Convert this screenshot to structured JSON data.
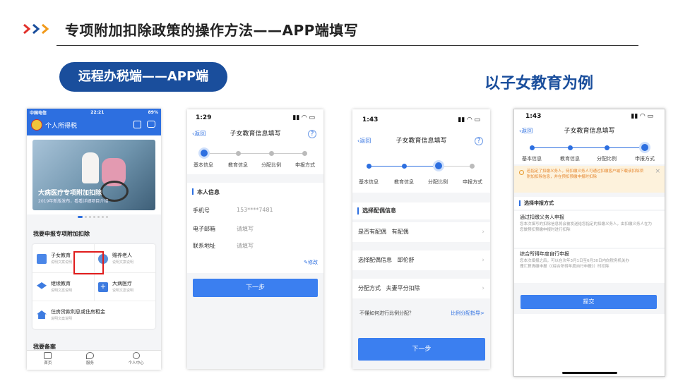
{
  "slide": {
    "title": "专项附加扣除政策的操作方法——APP端填写",
    "pill": "远程办税端——APP端",
    "example": "以子女教育为例"
  },
  "colors": {
    "accent": "#1a4e9c",
    "chevron_red": "#e1312b",
    "chevron_blue": "#1a4e9c",
    "chevron_orange": "#f19a1b",
    "app_blue": "#3b7ff0"
  },
  "phone1": {
    "status": {
      "carrier": "中国电信",
      "time": "22:21",
      "battery": "89%"
    },
    "app_title": "个人所得税",
    "banner": {
      "title": "大病医疗专项附加扣除",
      "subtitle": "2019年新版发布，看看详细项目介绍"
    },
    "section_title": "我要申报专项附加扣除",
    "items": [
      {
        "label": "子女教育",
        "desc": "说明文案说明"
      },
      {
        "label": "赡养老人",
        "desc": "说明文案说明"
      },
      {
        "label": "继续教育",
        "desc": "说明文案说明"
      },
      {
        "label": "大病医疗",
        "desc": "说明文案说明"
      },
      {
        "label": "住房贷款利息或住房租金",
        "desc": "说明文案说明"
      }
    ],
    "backup_title": "我要备案",
    "tabs": [
      "首页",
      "服务",
      "个人中心"
    ]
  },
  "phone2": {
    "time": "1:29",
    "back": "返回",
    "nav_title": "子女教育信息填写",
    "steps": [
      "基本信息",
      "教育信息",
      "分配比例",
      "申报方式"
    ],
    "section": "本人信息",
    "fields": [
      {
        "label": "手机号",
        "value": "153****7481"
      },
      {
        "label": "电子邮箱",
        "value": "请填写"
      },
      {
        "label": "联系地址",
        "value": "请填写"
      }
    ],
    "edit": "修改",
    "next": "下一步"
  },
  "phone3": {
    "time": "1:43",
    "back": "返回",
    "nav_title": "子女教育信息填写",
    "steps": [
      "基本信息",
      "教育信息",
      "分配比例",
      "申报方式"
    ],
    "section": "选择配偶信息",
    "rows": [
      {
        "label": "是否有配偶",
        "value": "有配偶"
      },
      {
        "label": "选择配偶信息",
        "value": "邱伦舒"
      },
      {
        "label": "分配方式",
        "value": "夫妻平分扣除"
      }
    ],
    "hint": "不懂如何进行比例分配？",
    "guide": "比例分配指导>",
    "next": "下一步"
  },
  "phone4": {
    "time": "1:43",
    "back": "返回",
    "nav_title": "子女教育信息填写",
    "steps": [
      "基本信息",
      "教育信息",
      "分配比例",
      "申报方式"
    ],
    "notice": "若指定了扣缴义务人，待扣缴义务人可通过扣缴客户端下载该扣除项附加扣除信息，并在预扣预缴申报时扣除",
    "section": "选择申报方式",
    "options": [
      {
        "title": "通过扣缴义务人申报",
        "desc": "您本次填写的扣除信息将会被发送给您指定的扣缴义务人，由扣缴义务人在为您做预扣预缴申报时进行扣除"
      },
      {
        "title": "综合所得年度自行申报",
        "desc": "您本次填报之后，可以在次年3月1日至6月30日内向税务机关办理汇算清缴申报（《综合所得年度自行申报》）时扣除"
      }
    ],
    "submit": "提交"
  }
}
